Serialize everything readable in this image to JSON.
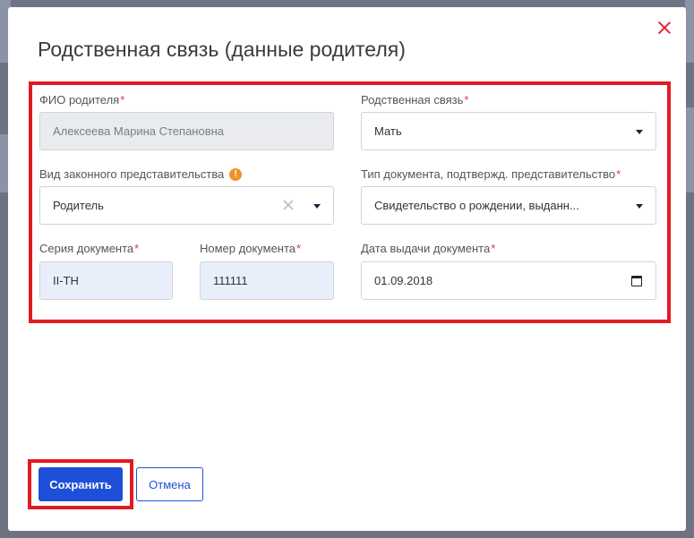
{
  "dialog": {
    "title": "Родственная связь (данные родителя)"
  },
  "fields": {
    "parent_name": {
      "label": "ФИО родителя",
      "required": "*",
      "value": "Алексеева Марина Степановна"
    },
    "relation": {
      "label": "Родственная связь",
      "required": "*",
      "value": "Мать"
    },
    "representation_type": {
      "label": "Вид законного представительства",
      "info": "!",
      "value": "Родитель"
    },
    "doc_type": {
      "label": "Тип документа, подтвержд. представительство",
      "required": "*",
      "value": "Свидетельство о рождении, выданн..."
    },
    "doc_series": {
      "label": "Серия документа",
      "required": "*",
      "value": "II-TH"
    },
    "doc_number": {
      "label": "Номер документа",
      "required": "*",
      "value": "111111"
    },
    "doc_date": {
      "label": "Дата выдачи документа",
      "required": "*",
      "value": "01.09.2018"
    }
  },
  "buttons": {
    "save": "Сохранить",
    "cancel": "Отмена"
  },
  "colors": {
    "accent": "#1e4fd8",
    "highlight": "#e11b22",
    "required": "#e5343f",
    "info": "#f0932b"
  }
}
